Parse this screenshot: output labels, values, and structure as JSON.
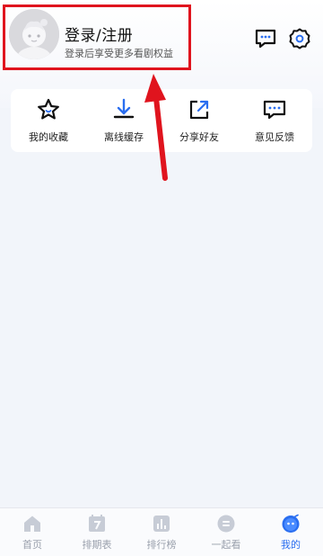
{
  "profile": {
    "title": "登录/注册",
    "subtitle": "登录后享受更多看剧权益",
    "avatar_icon": "avatar-icon"
  },
  "header_actions": [
    {
      "name": "message-icon"
    },
    {
      "name": "settings-icon"
    }
  ],
  "quick_actions": [
    {
      "label": "我的收藏",
      "icon": "star-icon"
    },
    {
      "label": "离线缓存",
      "icon": "download-icon"
    },
    {
      "label": "分享好友",
      "icon": "share-icon"
    },
    {
      "label": "意见反馈",
      "icon": "feedback-icon"
    }
  ],
  "tabbar": [
    {
      "label": "首页",
      "icon": "home-icon",
      "active": false
    },
    {
      "label": "排期表",
      "icon": "calendar-icon",
      "active": false
    },
    {
      "label": "排行榜",
      "icon": "ranking-icon",
      "active": false
    },
    {
      "label": "一起看",
      "icon": "watch-together-icon",
      "active": false
    },
    {
      "label": "我的",
      "icon": "mine-icon",
      "active": true
    }
  ],
  "colors": {
    "highlight": "#e0141e",
    "active_tab": "#2a6ef0",
    "inactive_tab": "#9aa0ac"
  }
}
